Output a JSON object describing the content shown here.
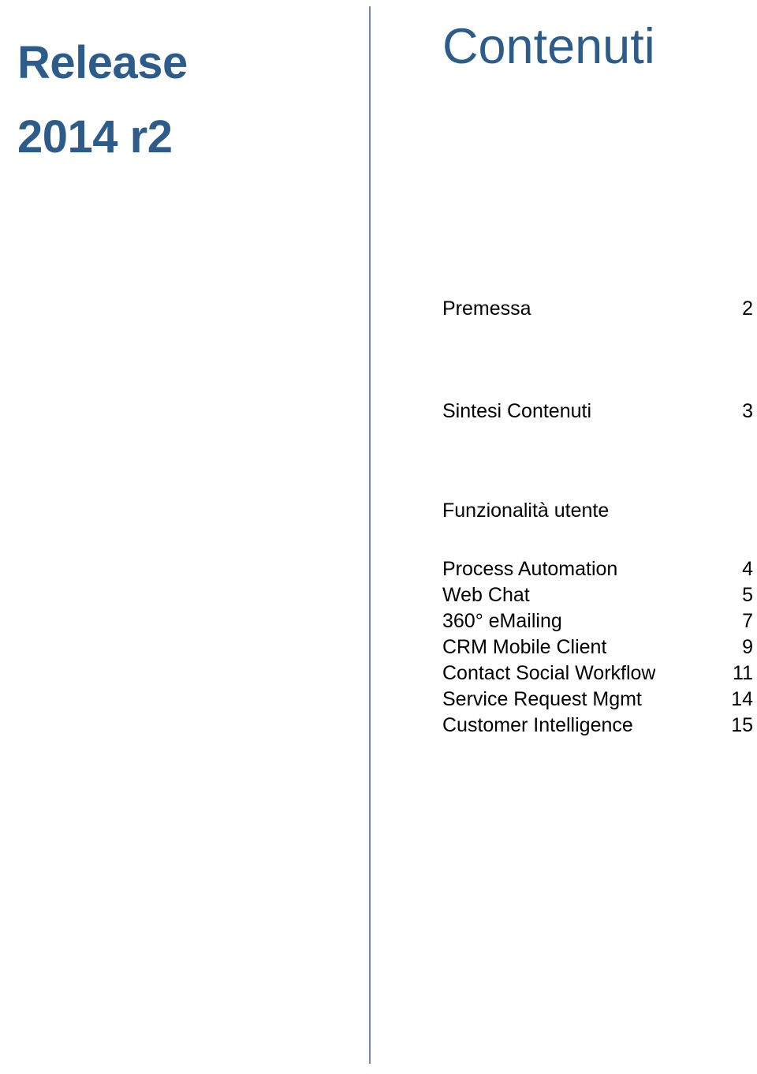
{
  "document": {
    "colors": {
      "accent_blue": "#2E5C8A",
      "divider_blue": "#6E88B4",
      "body_text": "#000000",
      "background": "#FFFFFF"
    }
  },
  "release_title": {
    "line1": "Release",
    "line2": "2014 r2"
  },
  "contents": {
    "heading": "Contenuti",
    "entries": [
      {
        "label": "Premessa",
        "page": "2"
      },
      {
        "label": "Sintesi Contenuti",
        "page": "3"
      },
      {
        "label": "Funzionalità utente",
        "page": ""
      },
      {
        "label": "Process Automation",
        "page": "4"
      },
      {
        "label": "Web Chat",
        "page": "5"
      },
      {
        "label": "360° eMailing",
        "page": "7"
      },
      {
        "label": "CRM Mobile Client",
        "page": "9"
      },
      {
        "label": "Contact Social Workflow",
        "page": "11"
      },
      {
        "label": "Service Request Mgmt",
        "page": "14"
      },
      {
        "label": "Customer Intelligence",
        "page": "15"
      }
    ]
  }
}
